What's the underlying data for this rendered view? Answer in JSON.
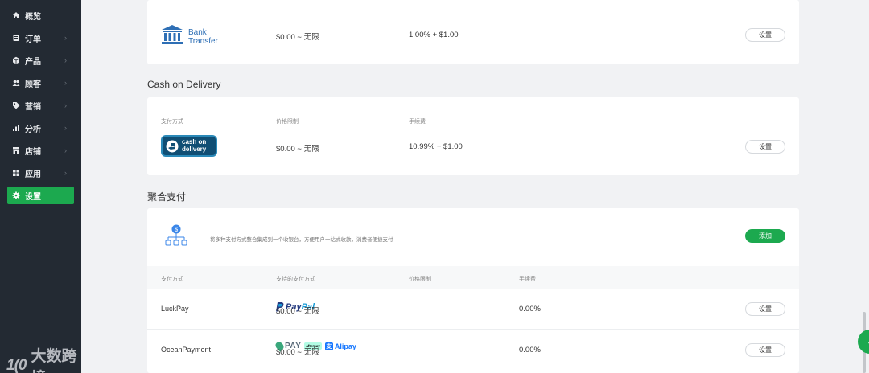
{
  "sidebar": {
    "items": [
      {
        "label": "概览",
        "icon": "home-icon",
        "has_chevron": false,
        "active": false
      },
      {
        "label": "订单",
        "icon": "order-icon",
        "has_chevron": true,
        "active": false
      },
      {
        "label": "产品",
        "icon": "product-box-icon",
        "has_chevron": true,
        "active": false
      },
      {
        "label": "顾客",
        "icon": "customers-icon",
        "has_chevron": true,
        "active": false
      },
      {
        "label": "营销",
        "icon": "tag-icon",
        "has_chevron": true,
        "active": false
      },
      {
        "label": "分析",
        "icon": "bar-chart-icon",
        "has_chevron": true,
        "active": false
      },
      {
        "label": "店铺",
        "icon": "store-icon",
        "has_chevron": true,
        "active": false
      },
      {
        "label": "应用",
        "icon": "apps-grid-icon",
        "has_chevron": true,
        "active": false
      },
      {
        "label": "设置",
        "icon": "gear-icon",
        "has_chevron": false,
        "active": true
      }
    ],
    "accent": "#1ca94f",
    "background": "#232a33"
  },
  "watermark": {
    "logo": "1(0",
    "text": "大数跨境"
  },
  "bank_transfer": {
    "logo_line1": "Bank",
    "logo_line2": "Transfer",
    "range": "$0.00 ~ 无限",
    "fee": "1.00% + $1.00",
    "button": "设置"
  },
  "cod": {
    "title": "Cash on Delivery",
    "headers": {
      "method": "支付方式",
      "limit": "价格限制",
      "fee": "手续费"
    },
    "logo_line1": "cash on",
    "logo_line2": "delivery",
    "range": "$0.00 ~ 无限",
    "fee": "10.99% + $1.00",
    "button": "设置"
  },
  "aggregate": {
    "title": "聚合支付",
    "description": "将多种支付方式整合集成到一个收银台，方便用户一站式收款，消费者便捷支付",
    "add_button": "添加",
    "headers": {
      "method": "支付方式",
      "supported": "支持的支付方式",
      "limit": "价格限制",
      "fee": "手续费"
    },
    "rows": [
      {
        "name": "LuckPay",
        "logos": "PayPal",
        "range": "$0.00 ~ 无限",
        "fee": "0.00%",
        "button": "设置"
      },
      {
        "name": "OceanPayment",
        "logos": "PAY / afterpay / Alipay",
        "range": "$0.00 ~ 无限",
        "fee": "0.00%",
        "button": "设置"
      }
    ]
  },
  "logos": {
    "paypal_a": "Pay",
    "paypal_b": "Pal",
    "gpay": "PAY",
    "afterpay": "afterpay",
    "alipay": "Alipay",
    "alipay_mark": "支"
  }
}
